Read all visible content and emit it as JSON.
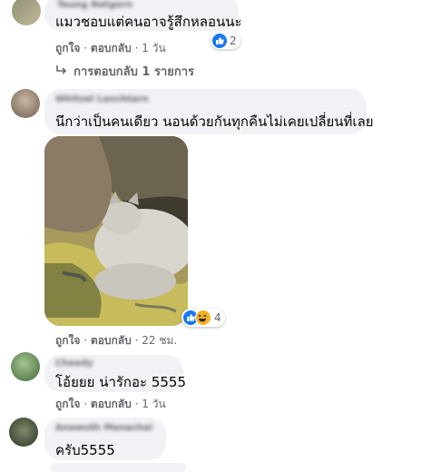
{
  "comments": [
    {
      "name": "Taung Natgorn",
      "text": "แมวชอบแต่คนอาจรู้สึกหลอนนะ",
      "like_label": "ถูกใจ",
      "reply_label": "ตอบกลับ",
      "time": "1 วัน",
      "reaction_count": "2"
    },
    {
      "name": "Whitzel Lanchtarn",
      "text": "นึกว่าเป็นคนเดียว นอนด้วยกันทุกคืนไม่เคยเปลี่ยนที่เลย",
      "like_label": "ถูกใจ",
      "reply_label": "ตอบกลับ",
      "time": "22 ชม.",
      "reaction_count": "4"
    },
    {
      "name": "Cheedy",
      "text": "โอ้ยยย น่ารักอะ 5555",
      "like_label": "ถูกใจ",
      "reply_label": "ตอบกลับ",
      "time": "1 วัน"
    },
    {
      "name": "Anawuth Manachai",
      "text": "ครับ5555"
    }
  ],
  "replies_link": "การตอบกลับ 1 รายการ",
  "separator": "·",
  "colors": {
    "bubble": "#f0f2f5",
    "like_blue": "#1877f2",
    "meta": "#65676b"
  }
}
